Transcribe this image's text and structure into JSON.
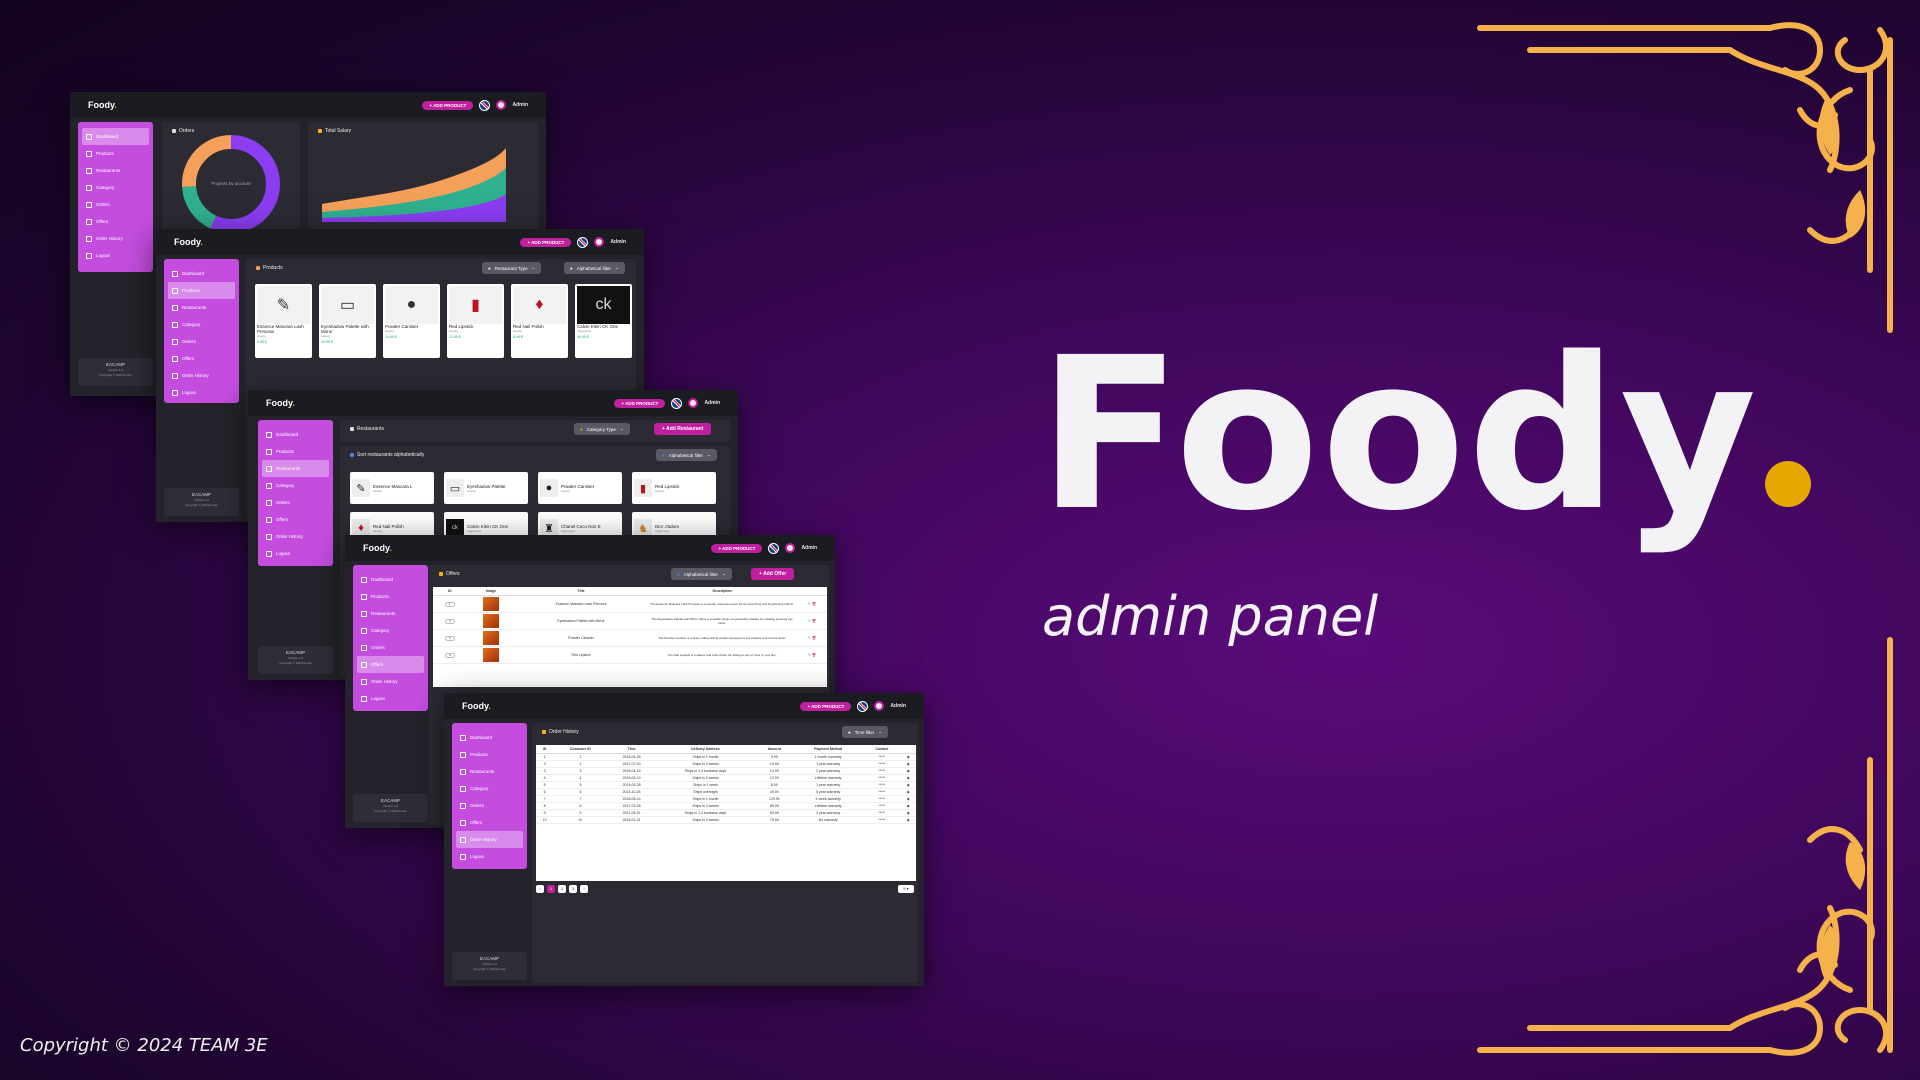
{
  "hero": {
    "title": "Foody",
    "subtitle": "admin panel"
  },
  "footer": {
    "copyright": "Copyright © 2024 TEAM 3E"
  },
  "colors": {
    "accent": "#c0209e",
    "sidebar": "#c44de0",
    "logo_dot": "#e6a800",
    "ornament": "#f6b24a"
  },
  "app": {
    "logo": "Foody",
    "add_product": "+ ADD PRODUCT",
    "admin": "Admin",
    "brand": "EACAMP",
    "version": "Version 1.0",
    "copyright_mini": "Copyright © 2024 Foody",
    "sidebar": [
      "Dashboard",
      "Products",
      "Restaurants",
      "Category",
      "Orders",
      "Offers",
      "Order History",
      "Logout"
    ]
  },
  "dashboard": {
    "orders_title": "Orders",
    "donut_label": "Projects by account",
    "salary_title": "Total Salary"
  },
  "products": {
    "title": "Products",
    "filter_type": "Restaurant Type",
    "filter_alpha": "Alphabetical filter",
    "items": [
      {
        "name": "Essence Mascara Lash Princess",
        "cat": "beauty",
        "price": "9.99 $",
        "icon": "mascara-icon"
      },
      {
        "name": "Eyeshadow Palette with Mirror",
        "cat": "beauty",
        "price": "19.99 $",
        "icon": "palette-icon"
      },
      {
        "name": "Powder Canister",
        "cat": "beauty",
        "price": "14.99 $",
        "icon": "powder-icon"
      },
      {
        "name": "Red Lipstick",
        "cat": "beauty",
        "price": "12.99 $",
        "icon": "lipstick-icon"
      },
      {
        "name": "Red Nail Polish",
        "cat": "beauty",
        "price": "8.99 $",
        "icon": "nailpolish-icon"
      },
      {
        "name": "Calvin Klein CK One",
        "cat": "fragrances",
        "price": "49.99 $",
        "icon": "perfume-icon"
      }
    ]
  },
  "restaurants": {
    "title": "Restaurants",
    "filter_cat": "Category Type",
    "add_btn": "Add Restaurant",
    "sort_title": "Sort restaurants alphabetically",
    "filter_alpha": "Alphabetical filter",
    "items": [
      {
        "name": "Essence Mascara L",
        "cat": "beauty"
      },
      {
        "name": "Eyeshadow Palette",
        "cat": "beauty"
      },
      {
        "name": "Powder Canister",
        "cat": "beauty"
      },
      {
        "name": "Red Lipstick",
        "cat": "beauty"
      },
      {
        "name": "Red Nail Polish",
        "cat": "beauty"
      },
      {
        "name": "Calvin Klein CK One",
        "cat": "fragrances"
      },
      {
        "name": "Chanel Coco Noir E",
        "cat": "fragrances"
      },
      {
        "name": "Dior J'adore",
        "cat": "fragrances"
      }
    ]
  },
  "offers": {
    "title": "Offers",
    "filter_alpha": "Alphabetical filter",
    "add_btn": "Add Offer",
    "columns": [
      "ID",
      "Image",
      "Title",
      "Description"
    ],
    "rows": [
      {
        "id": "1",
        "title": "Essence Mascara Lash Princess",
        "desc": "The Essence Mascara Lash Princess is a popular mascara known for its volumizing and lengthening effects."
      },
      {
        "id": "2",
        "title": "Eyeshadow Palette with Mirror",
        "desc": "The Eyeshadow Palette with Mirror offers a versatile range of eyeshadow shades for creating stunning eye looks."
      },
      {
        "id": "3",
        "title": "Powder Canister",
        "desc": "The Powder Canister is a finely milled setting powder designed to set makeup and control shine."
      },
      {
        "id": "4",
        "title": "Red Lipstick",
        "desc": "The Red Lipstick is a classic and bold choice for adding a pop of color to your lips."
      }
    ]
  },
  "history": {
    "title": "Order History",
    "filter_time": "Time filter",
    "columns": [
      "ID",
      "Customer ID",
      "Time",
      "Delivery Address",
      "Amount",
      "Payment Method",
      "Contact"
    ],
    "rows": [
      [
        "1",
        "1",
        "2015-05-28",
        "Ships in 1 month",
        "9.99",
        "1 month warranty",
        "*****"
      ],
      [
        "2",
        "2",
        "2017-07-30",
        "Ships in 2 weeks",
        "19.99",
        "1 year warranty",
        "*****"
      ],
      [
        "3",
        "3",
        "2018-04-15",
        "Ships in 1-2 business days",
        "14.99",
        "2 year warranty",
        "*****"
      ],
      [
        "4",
        "4",
        "2015-05-19",
        "Ships in 2 weeks",
        "12.99",
        "Lifetime warranty",
        "*****"
      ],
      [
        "5",
        "5",
        "2015-05-28",
        "Ships in 1 week",
        "8.99",
        "1 year warranty",
        "*****"
      ],
      [
        "6",
        "6",
        "2015-10-24",
        "Ships overnight",
        "49.99",
        "5 year warranty",
        "*****"
      ],
      [
        "7",
        "7",
        "2018-08-14",
        "Ships in 1 month",
        "129.99",
        "3 week warranty",
        "*****"
      ],
      [
        "8",
        "8",
        "2017-03-28",
        "Ships in 2 weeks",
        "89.99",
        "Lifetime warranty",
        "*****"
      ],
      [
        "9",
        "9",
        "2021-08-21",
        "Ships in 1-2 business days",
        "69.99",
        "3 year warranty",
        "*****"
      ],
      [
        "10",
        "10",
        "2015-02-21",
        "Ships in 2 weeks",
        "79.99",
        "No warranty",
        "*****"
      ]
    ],
    "pages": [
      "‹",
      "1",
      "2",
      "3",
      "›"
    ],
    "per_page": "5 ▾"
  }
}
